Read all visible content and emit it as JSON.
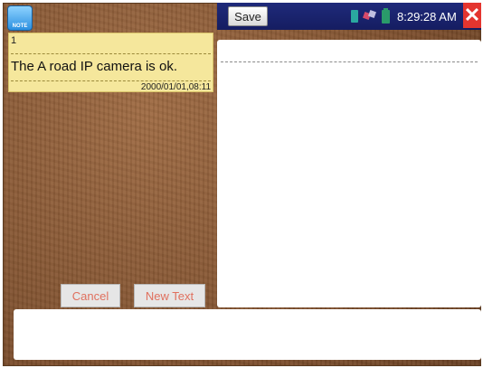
{
  "app": {
    "icon_label": "NOTE"
  },
  "toolbar": {
    "save_label": "Save"
  },
  "status": {
    "time": "8:29:28 AM"
  },
  "note": {
    "id": "1",
    "text": "The A road IP camera is ok.",
    "timestamp": "2000/01/01,08:11"
  },
  "actions": {
    "cancel_label": "Cancel",
    "new_text_label": "New Text"
  },
  "colors": {
    "topbar": "#1f2a7a",
    "note_bg": "#f5e79c",
    "button_text": "#e0705e",
    "close": "#e4352f"
  }
}
